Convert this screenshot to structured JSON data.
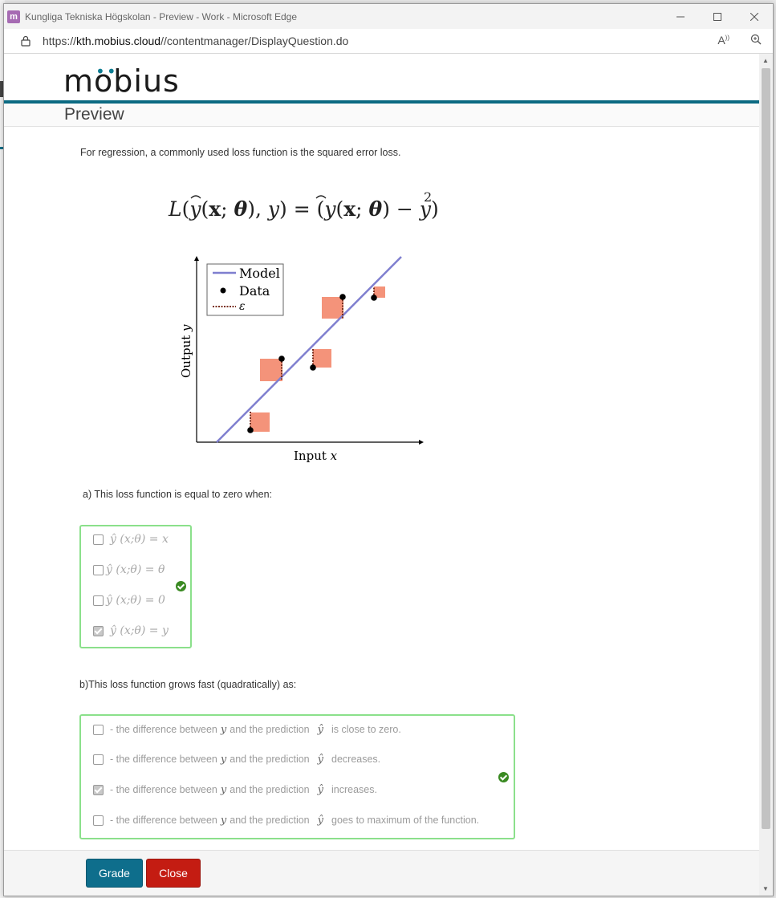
{
  "browser": {
    "window_title": "Kungliga Tekniska Högskolan - Preview - Work - Microsoft Edge",
    "url_prefix": "https://",
    "url_host": "kth.mobius.cloud",
    "url_path": "//contentmanager/DisplayQuestion.do",
    "icons": [
      "app-icon",
      "minimize-icon",
      "maximize-icon",
      "close-icon",
      "lock-icon",
      "read-aloud-icon",
      "zoom-icon"
    ]
  },
  "app": {
    "logo": "möbius",
    "preview_title": "Preview"
  },
  "question": {
    "intro": "For regression, a commonly used loss function is the squared error loss.",
    "plot": {
      "legend_model": "Model",
      "legend_data": "Data",
      "legend_eps": "ε",
      "xlabel_text": "Input ",
      "xlabel_var": "x",
      "ylabel_text": "Output ",
      "ylabel_var": "y"
    },
    "part_a": {
      "prompt": "a) This loss function is equal to zero when:",
      "options": [
        {
          "math": "ŷ (x;θ) = x",
          "checked": false
        },
        {
          "math": "ŷ (x;θ) = θ",
          "checked": false
        },
        {
          "math": "ŷ (x;θ) = 0",
          "checked": false
        },
        {
          "math": "ŷ (x;θ) = y",
          "checked": true
        }
      ]
    },
    "part_b": {
      "prompt": "b)This loss function grows fast (quadratically) as:",
      "lead": "- the difference between",
      "var_y": "y",
      "mid": "and the prediction",
      "var_yhat": "ŷ",
      "options": [
        {
          "tail": "is close to zero.",
          "checked": false
        },
        {
          "tail": "decreases.",
          "checked": false
        },
        {
          "tail": "increases.",
          "checked": true
        },
        {
          "tail": "goes to maximum of the function.",
          "checked": false
        }
      ]
    }
  },
  "footer": {
    "grade_label": "Grade",
    "close_label": "Close"
  },
  "colors": {
    "teal": "#0b6a82",
    "grade": "#0e6e8c",
    "close": "#c41c12",
    "correct_border": "#8be08b",
    "model_line": "#7f7fcf",
    "residual_square": "#f4937a"
  }
}
